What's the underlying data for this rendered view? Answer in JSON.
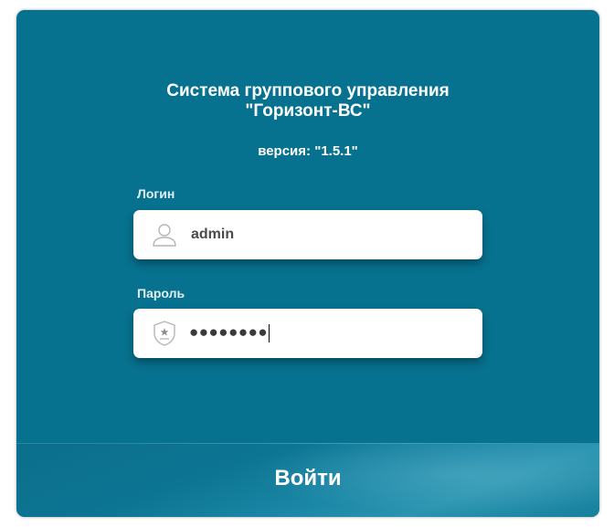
{
  "app": {
    "title_line1": "Система группового управления",
    "title_line2": "\"Горизонт-ВС\"",
    "version_label": "версия:",
    "version_value": "\"1.5.1\""
  },
  "login": {
    "label": "Логин",
    "value": "admin",
    "icon": "user-icon"
  },
  "password": {
    "label": "Пароль",
    "masked_value": "●●●●●●●●",
    "icon": "shield-star-icon"
  },
  "submit": {
    "label": "Войти"
  },
  "colors": {
    "panel": "#07728f",
    "field_bg": "#ffffff",
    "text_light": "#ffffff"
  }
}
